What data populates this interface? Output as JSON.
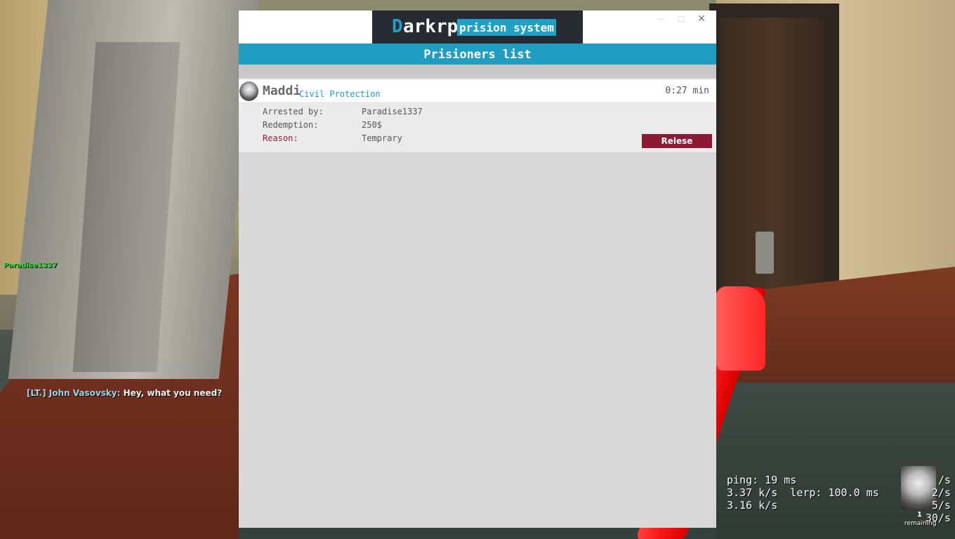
{
  "window": {
    "brand_first_letter": "D",
    "brand_rest": "arkrp",
    "brand_subtitle": "prision system",
    "controls": {
      "minimize": "—",
      "maximize": "□",
      "close": "✕"
    }
  },
  "list": {
    "header": "Prisioners list",
    "entries": [
      {
        "name": "Maddi",
        "team": "Civil Protection",
        "time": "0:27 min",
        "arrested_by_label": "Arrested by:",
        "arrested_by": "Paradise1337",
        "redemption_label": "Redemption:",
        "redemption": "250$",
        "reason_label": "Reason:",
        "reason": "Temprary",
        "release_label": "Relese"
      }
    ]
  },
  "hud": {
    "player_tag": "Paradise1337",
    "chat": {
      "speaker": "[LT.] John Vasovsky:",
      "message": " Hey, what you need?"
    },
    "netgraph": {
      "line1": "ping: 19 ms",
      "line2": "3.37 k/s  lerp: 100.0 ms",
      "line3": "3.16 k/s"
    },
    "rates": [
      "/s",
      "2/s",
      "5/s",
      "30/s"
    ],
    "count": "1",
    "remaining": "remaining"
  },
  "colors": {
    "accent": "#1f9ec2",
    "brand_bg": "#262b33",
    "release": "#8c1a35",
    "player_tag": "#2fe12f"
  }
}
